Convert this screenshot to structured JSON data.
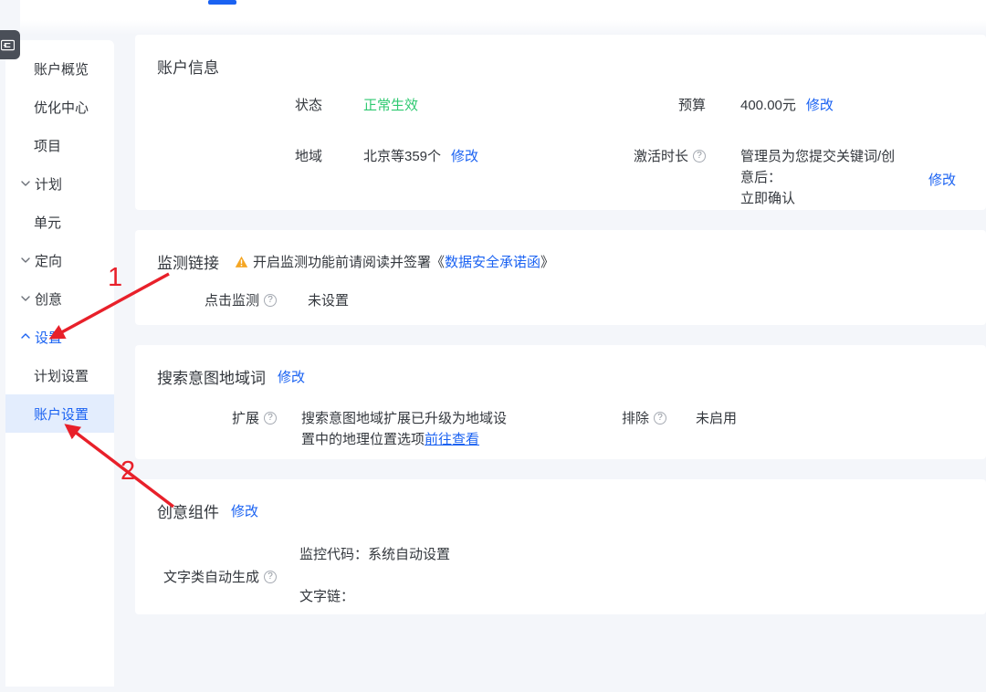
{
  "sidebar": {
    "collapse_icon": "sidebar-collapse-icon",
    "items": [
      {
        "label": "账户概览",
        "caret": "",
        "state": "normal"
      },
      {
        "label": "优化中心",
        "caret": "",
        "state": "normal"
      },
      {
        "label": "项目",
        "caret": "",
        "state": "normal"
      },
      {
        "label": "计划",
        "caret": "chevron-down-icon",
        "state": "normal"
      },
      {
        "label": "单元",
        "caret": "",
        "state": "normal"
      },
      {
        "label": "定向",
        "caret": "chevron-down-icon",
        "state": "normal"
      },
      {
        "label": "创意",
        "caret": "chevron-down-icon",
        "state": "normal"
      },
      {
        "label": "设置",
        "caret": "chevron-up-icon",
        "state": "expanded"
      },
      {
        "label": "计划设置",
        "caret": "",
        "state": "normal"
      },
      {
        "label": "账户设置",
        "caret": "",
        "state": "active"
      }
    ]
  },
  "account_info": {
    "title": "账户信息",
    "status_label": "状态",
    "status_value": "正常生效",
    "region_label": "地域",
    "region_value": "北京等359个",
    "region_edit": "修改",
    "budget_label": "预算",
    "budget_value": "400.00元",
    "budget_edit": "修改",
    "activation_label": "激活时长",
    "activation_value_line1": "管理员为您提交关键词/创意后：",
    "activation_value_line2": "立即确认",
    "activation_edit": "修改"
  },
  "monitor": {
    "title": "监测链接",
    "warning_text_prefix": "开启监测功能前请阅读并签署《",
    "warning_link": "数据安全承诺函",
    "warning_text_suffix": "》",
    "click_monitor_label": "点击监测",
    "click_monitor_value": "未设置"
  },
  "search_intent": {
    "title": "搜索意图地域词",
    "title_edit": "修改",
    "expand_label": "扩展",
    "expand_value_line1": "搜索意图地域扩展已升级为地域设",
    "expand_value_line2": "置中的地理位置选项",
    "expand_value_link": "前往查看",
    "exclude_label": "排除",
    "exclude_value": "未启用"
  },
  "creative_component": {
    "title": "创意组件",
    "title_edit": "修改",
    "auto_text_label": "文字类自动生成",
    "monitor_code_text": "监控代码：系统自动设置",
    "text_link_text": "文字链："
  },
  "annotations": [
    {
      "number": "1",
      "target": "设置"
    },
    {
      "number": "2",
      "target": "账户设置"
    }
  ],
  "colors": {
    "accent": "#1a62f2",
    "success": "#2fc971",
    "warning": "#f5a623",
    "annotation": "#e8202a",
    "page_bg": "#f4f6fa"
  }
}
